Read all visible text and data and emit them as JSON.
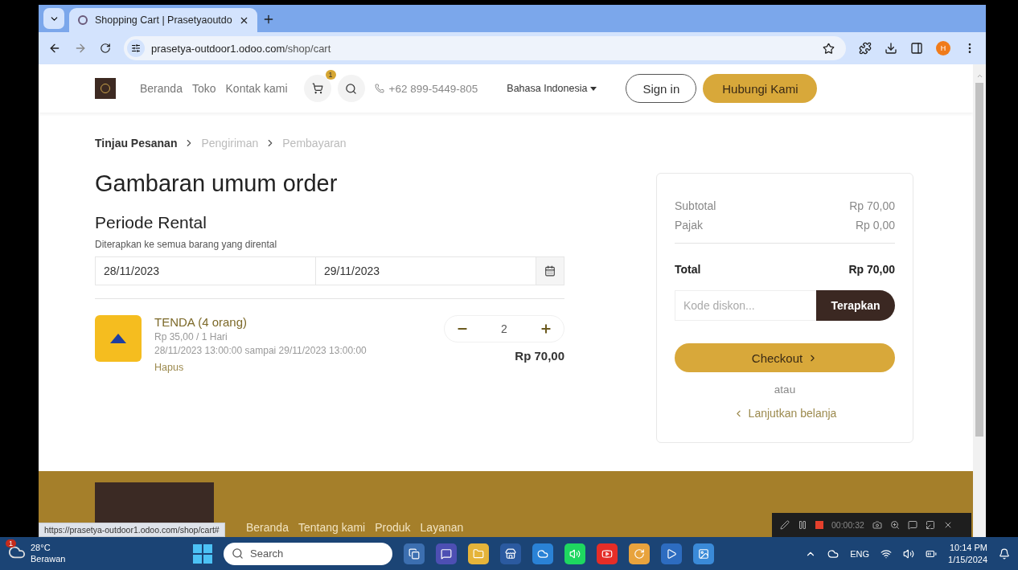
{
  "browser": {
    "tabs": [
      {
        "title": "Shopping Cart | Prasetyaoutdo",
        "selected": true
      }
    ],
    "url_host": "prasetya-outdoor1.odoo.com",
    "url_path": "/shop/cart",
    "profile_initial": "H"
  },
  "header": {
    "nav": [
      "Beranda",
      "Toko",
      "Kontak kami"
    ],
    "cart_count": "1",
    "phone": "+62 899-5449-805",
    "language": "Bahasa Indonesia",
    "sign_in": "Sign in",
    "cta": "Hubungi Kami"
  },
  "breadcrumb": [
    {
      "label": "Tinjau Pesanan",
      "selected": true
    },
    {
      "label": "Pengiriman",
      "selected": false
    },
    {
      "label": "Pembayaran",
      "selected": false
    }
  ],
  "heading": "Gambaran umum order",
  "rental": {
    "title": "Periode Rental",
    "hint": "Diterapkan ke semua barang yang dirental",
    "start_date": "28/11/2023",
    "end_date": "29/11/2023"
  },
  "items": [
    {
      "name": "TENDA (4 orang)",
      "price": "Rp 35,00 / 1 Hari",
      "period": "28/11/2023 13:00:00 sampai 29/11/2023 13:00:00",
      "remove": "Hapus",
      "quantity": "2",
      "subtotal": "Rp 70,00"
    }
  ],
  "summary": {
    "rows": [
      {
        "label": "Subtotal",
        "value": "Rp 70,00",
        "kind": "line"
      },
      {
        "label": "Pajak",
        "value": "Rp 0,00",
        "kind": "line"
      },
      {
        "label": "Total",
        "value": "Rp 70,00",
        "kind": "total"
      }
    ],
    "discount_placeholder": "Kode diskon...",
    "apply": "Terapkan",
    "checkout": "Checkout",
    "or": "atau",
    "continue": "Lanjutkan belanja"
  },
  "footer": {
    "links": [
      "Beranda",
      "Tentang kami",
      "Produk",
      "Layanan"
    ]
  },
  "status_url": "https://prasetya-outdoor1.odoo.com/shop/cart#",
  "recorder": {
    "timer": "00:00:32"
  },
  "taskbar": {
    "temperature": "28°C",
    "condition": "Berawan",
    "weather_badge": "1",
    "search": "Search",
    "language": "ENG",
    "time": "10:14 PM",
    "date": "1/15/2024"
  }
}
